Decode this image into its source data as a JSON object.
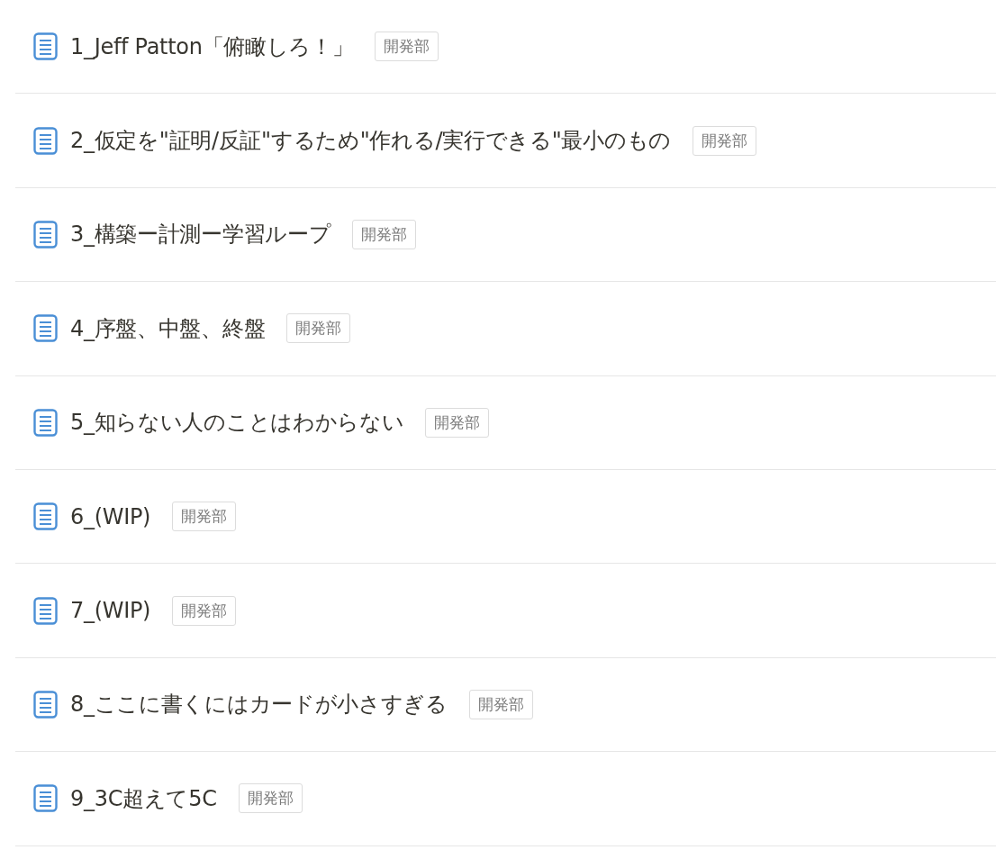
{
  "rows": [
    {
      "title": "1_Jeff Patton「俯瞰しろ！」",
      "tag": "開発部"
    },
    {
      "title": "2_仮定を\"証明/反証\"するため\"作れる/実行できる\"最小のもの",
      "tag": "開発部"
    },
    {
      "title": "3_構築ー計測ー学習ループ",
      "tag": "開発部"
    },
    {
      "title": "4_序盤、中盤、終盤",
      "tag": "開発部"
    },
    {
      "title": "5_知らない人のことはわからない",
      "tag": "開発部"
    },
    {
      "title": "6_(WIP)",
      "tag": "開発部"
    },
    {
      "title": "7_(WIP)",
      "tag": "開発部"
    },
    {
      "title": "8_ここに書くにはカードが小さすぎる",
      "tag": "開発部"
    },
    {
      "title": "9_3C超えて5C",
      "tag": "開発部"
    }
  ]
}
